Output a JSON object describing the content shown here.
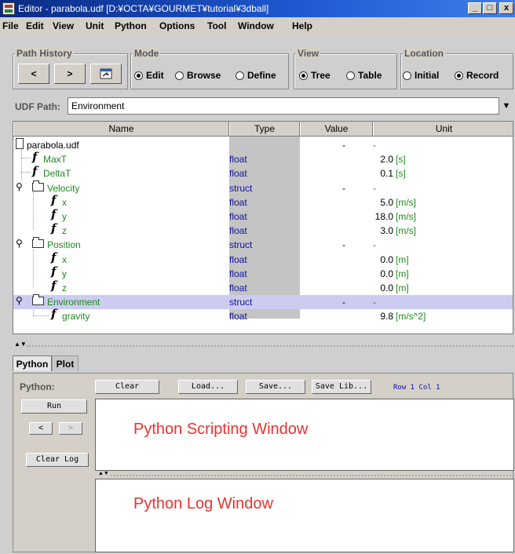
{
  "window": {
    "title": "Editor - parabola.udf [D:¥OCTA¥GOURMET¥tutorial¥3dball]",
    "min_label": "_",
    "max_label": "□",
    "close_label": "x"
  },
  "menu": [
    "File",
    "Edit",
    "View",
    "Unit",
    "Python",
    "Options",
    "Tool",
    "Window",
    "Help"
  ],
  "path_history": {
    "legend": "Path History",
    "back_label": "<",
    "forward_label": ">"
  },
  "mode": {
    "legend": "Mode",
    "options": [
      "Edit",
      "Browse",
      "Define"
    ],
    "selected": "Edit"
  },
  "view": {
    "legend": "View",
    "options": [
      "Tree",
      "Table"
    ],
    "selected": "Tree"
  },
  "location": {
    "legend": "Location",
    "options": [
      "Initial",
      "Record"
    ],
    "selected": "Record"
  },
  "udf_path": {
    "label": "UDF Path:",
    "value": "Environment"
  },
  "table": {
    "columns": [
      "Name",
      "Type",
      "Value",
      "Unit"
    ],
    "rows": [
      {
        "name": "parabola.udf",
        "type": "",
        "value": "-",
        "unit": "-",
        "kind": "file",
        "depth": 0
      },
      {
        "name": "MaxT",
        "type": "float",
        "value": "2.0",
        "unit": "[s]",
        "kind": "field",
        "depth": 1
      },
      {
        "name": "DeltaT",
        "type": "float",
        "value": "0.1",
        "unit": "[s]",
        "kind": "field",
        "depth": 1
      },
      {
        "name": "Velocity",
        "type": "struct",
        "value": "-",
        "unit": "-",
        "kind": "struct",
        "depth": 0
      },
      {
        "name": "x",
        "type": "float",
        "value": "5.0",
        "unit": "[m/s]",
        "kind": "field",
        "depth": 2
      },
      {
        "name": "y",
        "type": "float",
        "value": "18.0",
        "unit": "[m/s]",
        "kind": "field",
        "depth": 2
      },
      {
        "name": "z",
        "type": "float",
        "value": "3.0",
        "unit": "[m/s]",
        "kind": "field",
        "depth": 2
      },
      {
        "name": "Position",
        "type": "struct",
        "value": "-",
        "unit": "-",
        "kind": "struct",
        "depth": 0
      },
      {
        "name": "x",
        "type": "float",
        "value": "0.0",
        "unit": "[m]",
        "kind": "field",
        "depth": 2
      },
      {
        "name": "y",
        "type": "float",
        "value": "0.0",
        "unit": "[m]",
        "kind": "field",
        "depth": 2
      },
      {
        "name": "z",
        "type": "float",
        "value": "0.0",
        "unit": "[m]",
        "kind": "field",
        "depth": 2
      },
      {
        "name": "Environment",
        "type": "struct",
        "value": "-",
        "unit": "-",
        "kind": "struct",
        "depth": 0,
        "selected": true
      },
      {
        "name": "gravity",
        "type": "float",
        "value": "9.8",
        "unit": "[m/s^2]",
        "kind": "field",
        "depth": 2
      }
    ]
  },
  "bottom": {
    "tabs": [
      "Python",
      "Plot"
    ],
    "active_tab": "Python",
    "python_label": "Python:",
    "buttons": {
      "clear": "Clear",
      "load": "Load...",
      "save": "Save...",
      "save_lib": "Save Lib...",
      "run": "Run",
      "prev": "<",
      "next": ">",
      "clear_log": "Clear Log"
    },
    "row_col": "Row 1 Col 1",
    "script_window_text": "Python Scripting Window",
    "log_window_text": "Python Log Window"
  },
  "colors": {
    "title_bar": "#1f5ad4",
    "field_name": "#1e8a1e",
    "type_text": "#1010a0",
    "overlay_text": "#e8332e",
    "selected_row": "#ccccf0"
  }
}
